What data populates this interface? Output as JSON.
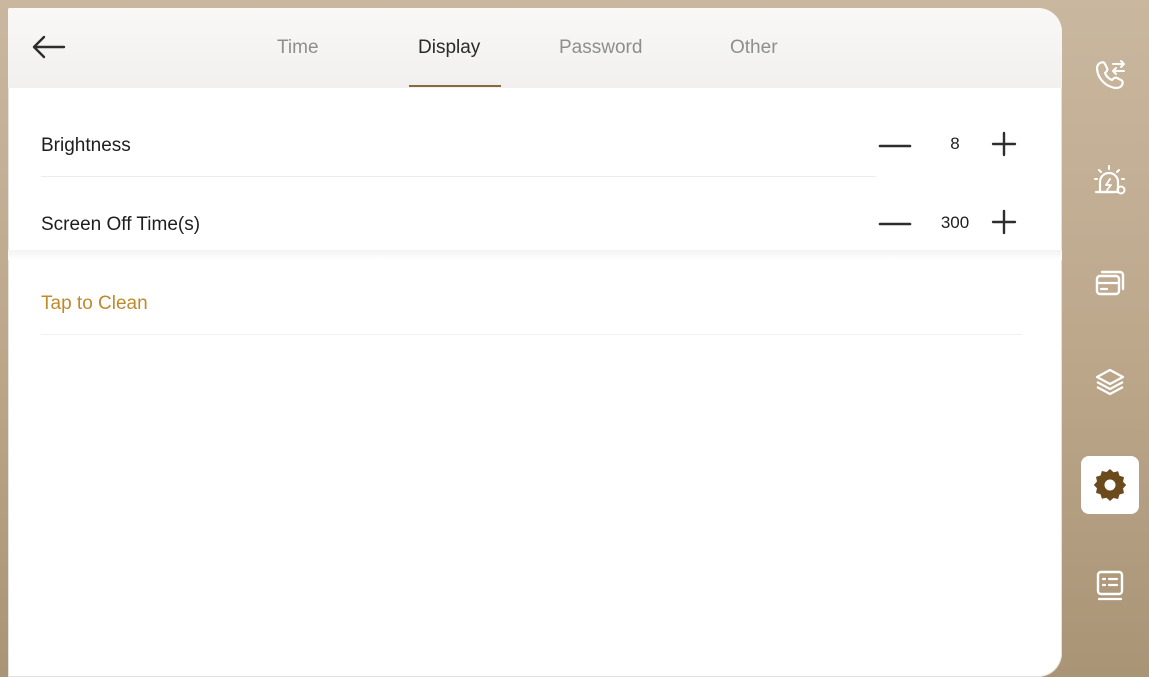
{
  "tabs": [
    {
      "label": "Time",
      "active": false
    },
    {
      "label": "Display",
      "active": true
    },
    {
      "label": "Password",
      "active": false
    },
    {
      "label": "Other",
      "active": false
    }
  ],
  "settings": {
    "brightness": {
      "label": "Brightness",
      "value": "8"
    },
    "screen_off": {
      "label": "Screen Off Time(s)",
      "value": "300"
    }
  },
  "clean": {
    "label": "Tap to Clean"
  },
  "sidebar": {
    "items": [
      {
        "name": "call-transfer-icon"
      },
      {
        "name": "alarm-icon"
      },
      {
        "name": "cards-icon"
      },
      {
        "name": "layers-icon"
      },
      {
        "name": "settings-gear-icon",
        "active": true
      },
      {
        "name": "list-icon"
      }
    ]
  },
  "colors": {
    "accent": "#8a6a3c",
    "clean_text": "#c08a2a",
    "sidebar_bg": "#bda88c"
  }
}
